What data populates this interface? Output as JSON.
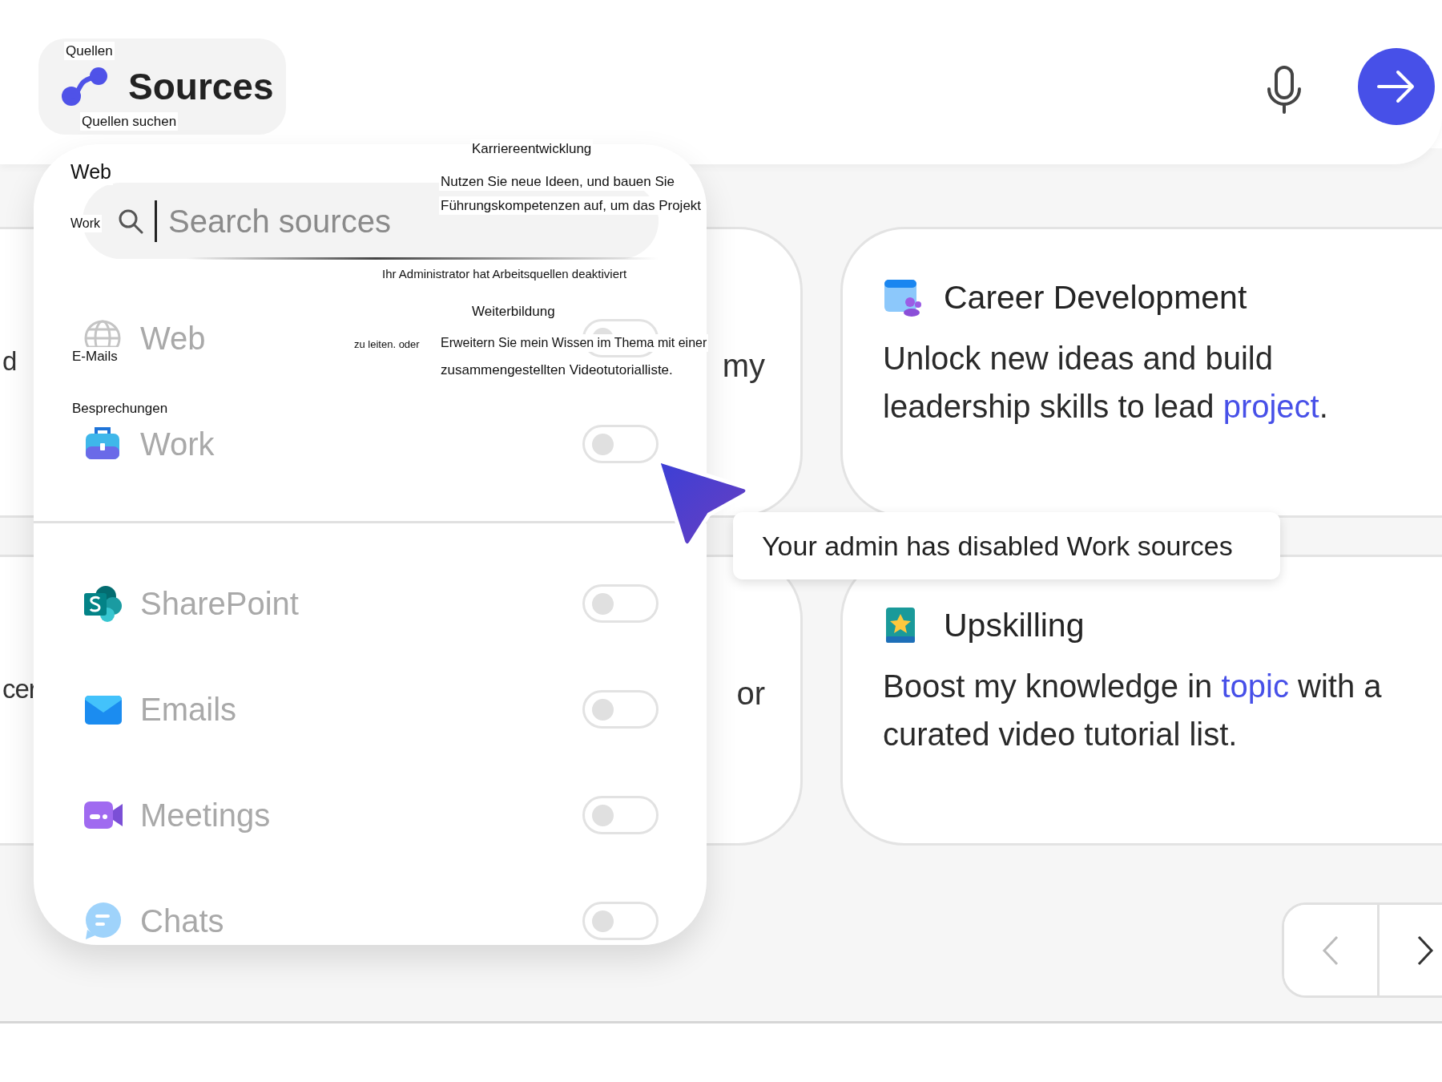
{
  "header": {
    "sources_button": {
      "label": "Sources"
    }
  },
  "sources_panel": {
    "search": {
      "placeholder": "Search sources"
    },
    "items": [
      {
        "kind": "web",
        "label": "Web",
        "on": false,
        "disabled": true
      },
      {
        "kind": "work",
        "label": "Work",
        "on": false,
        "disabled": true
      },
      {
        "kind": "sharepoint",
        "label": "SharePoint",
        "on": false,
        "disabled": true
      },
      {
        "kind": "emails",
        "label": "Emails",
        "on": false,
        "disabled": true
      },
      {
        "kind": "meetings",
        "label": "Meetings",
        "on": false,
        "disabled": true
      },
      {
        "kind": "chats",
        "label": "Chats",
        "on": false,
        "disabled": true
      }
    ]
  },
  "tooltip": {
    "text": "Your admin has disabled Work sources"
  },
  "partial_cards": [
    {
      "visible_text": [
        "d",
        "my"
      ]
    },
    {
      "visible_text": [
        "cer",
        "or"
      ]
    }
  ],
  "cards": [
    {
      "kind": "career",
      "title": "Career Development",
      "body_lines": [
        [
          {
            "text": "Unlock new ideas and build",
            "kind": "plain"
          }
        ],
        [
          {
            "text": "leadership skills to lead ",
            "kind": "plain"
          },
          {
            "text": "project",
            "kind": "slot"
          },
          {
            "text": ".",
            "kind": "plain"
          }
        ]
      ]
    },
    {
      "kind": "upskilling",
      "title": "Upskilling",
      "body_lines": [
        [
          {
            "text": "Boost my knowledge in ",
            "kind": "plain"
          },
          {
            "text": "topic",
            "kind": "slot"
          },
          {
            "text": " with a",
            "kind": "plain"
          }
        ],
        [
          {
            "text": "curated video tutorial list.",
            "kind": "plain"
          }
        ]
      ]
    }
  ],
  "translation_labels": [
    {
      "text": "Quellen"
    },
    {
      "text": "Quellen suchen"
    },
    {
      "text": "Karriereentwicklung"
    },
    {
      "text": "Web"
    },
    {
      "text": "Nutzen Sie neue Ideen, und bauen Sie"
    },
    {
      "text": "Führungskompetenzen auf, um das Projekt"
    },
    {
      "text": "Work"
    },
    {
      "text": "Ihr Administrator hat Arbeitsquellen deaktiviert"
    },
    {
      "text": "Weiterbildung"
    },
    {
      "text": "zu leiten. oder"
    },
    {
      "text": "Erweitern Sie mein Wissen im Thema mit einer"
    },
    {
      "text": "E-Mails"
    },
    {
      "text": "zusammengestellten Videotutorialliste."
    },
    {
      "text": "Besprechungen"
    }
  ]
}
